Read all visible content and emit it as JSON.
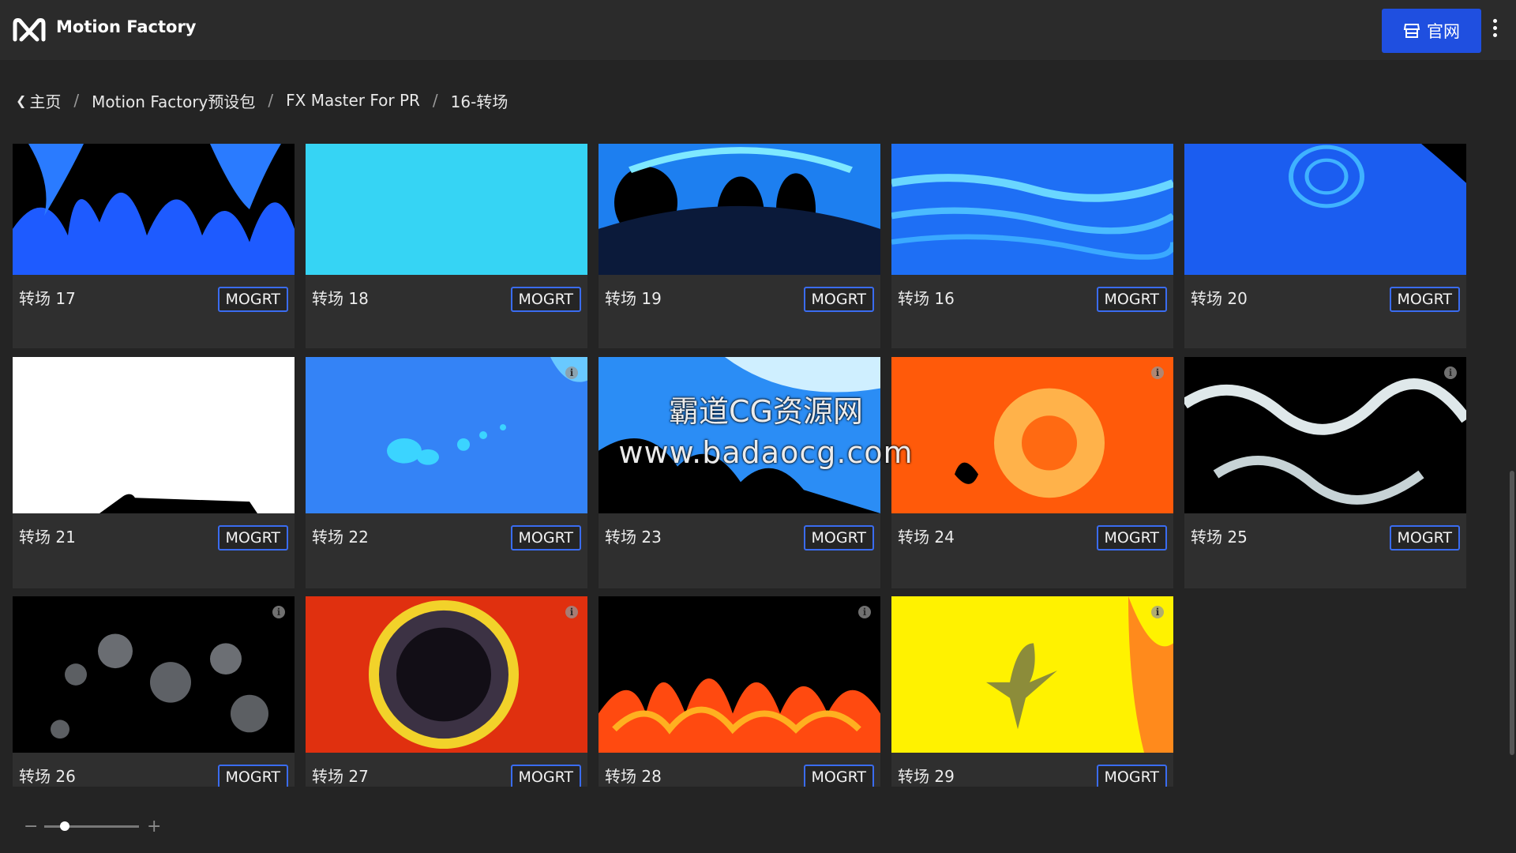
{
  "app": {
    "title": "Motion Factory",
    "site_button_label": "官网"
  },
  "breadcrumb": {
    "items": [
      "主页",
      "Motion Factory预设包",
      "FX Master For PR",
      "16-转场"
    ]
  },
  "badge_label": "MOGRT",
  "cards": [
    {
      "title": "转场 17",
      "theme": "blue-splash-dark",
      "info": false
    },
    {
      "title": "转场 18",
      "theme": "cyan-solid",
      "info": false
    },
    {
      "title": "转场 19",
      "theme": "blue-ring-dark",
      "info": false
    },
    {
      "title": "转场 16",
      "theme": "blue-waves",
      "info": false
    },
    {
      "title": "转场 20",
      "theme": "blue-swirl",
      "info": false
    },
    {
      "title": "转场 21",
      "theme": "white-solid",
      "info": false
    },
    {
      "title": "转场 22",
      "theme": "blue-drops",
      "info": true
    },
    {
      "title": "转场 23",
      "theme": "blue-light-splash",
      "info": false
    },
    {
      "title": "转场 24",
      "theme": "orange-fire",
      "info": true
    },
    {
      "title": "转场 25",
      "theme": "smoke-dark",
      "info": true
    },
    {
      "title": "转场 26",
      "theme": "grey-bubbles",
      "info": true
    },
    {
      "title": "转场 27",
      "theme": "fire-burst",
      "info": true
    },
    {
      "title": "转场 28",
      "theme": "flames-dark",
      "info": true
    },
    {
      "title": "转场 29",
      "theme": "yellow-burst",
      "info": true
    }
  ],
  "watermark": {
    "line1": "霸道CG资源网",
    "line2": "www.badaocg.com"
  },
  "colors": {
    "accent": "#1f4fe0",
    "badge_border": "#3a6cf0",
    "background": "#242424",
    "card": "#2f2f2f"
  }
}
